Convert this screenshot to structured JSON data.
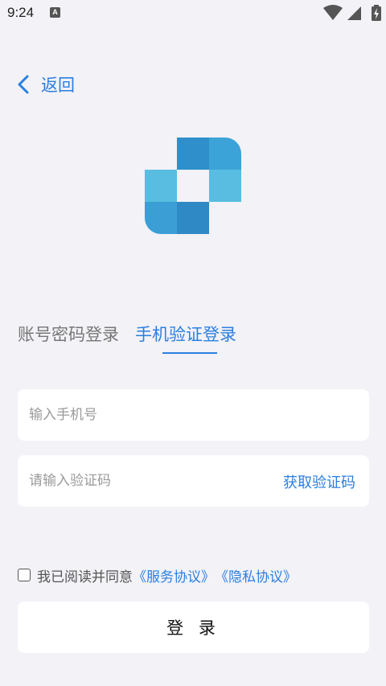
{
  "status_bar": {
    "time": "9:24",
    "notification_badge": "A",
    "icons": [
      "wifi-icon",
      "cell-signal-icon",
      "battery-charging-icon"
    ]
  },
  "nav": {
    "back_label": "返回",
    "back_icon": "chevron-left-icon"
  },
  "logo": {
    "colors": [
      "#2e8fcb",
      "#3ca3d8",
      "#58bde0",
      "#3b9fd5",
      "#2f89c4"
    ]
  },
  "tabs": [
    {
      "label": "账号密码登录",
      "active": false
    },
    {
      "label": "手机验证登录",
      "active": true
    }
  ],
  "form": {
    "phone_placeholder": "输入手机号",
    "phone_value": "",
    "code_placeholder": "请输入验证码",
    "code_value": "",
    "get_code_label": "获取验证码"
  },
  "agreement": {
    "checked": false,
    "text": "我已阅读并同意",
    "service_link": "《服务协议》",
    "privacy_link": "《隐私协议》"
  },
  "login_button_label": "登 录",
  "colors": {
    "accent": "#2b7fe0",
    "background": "#f2f2f7",
    "card": "#ffffff"
  }
}
